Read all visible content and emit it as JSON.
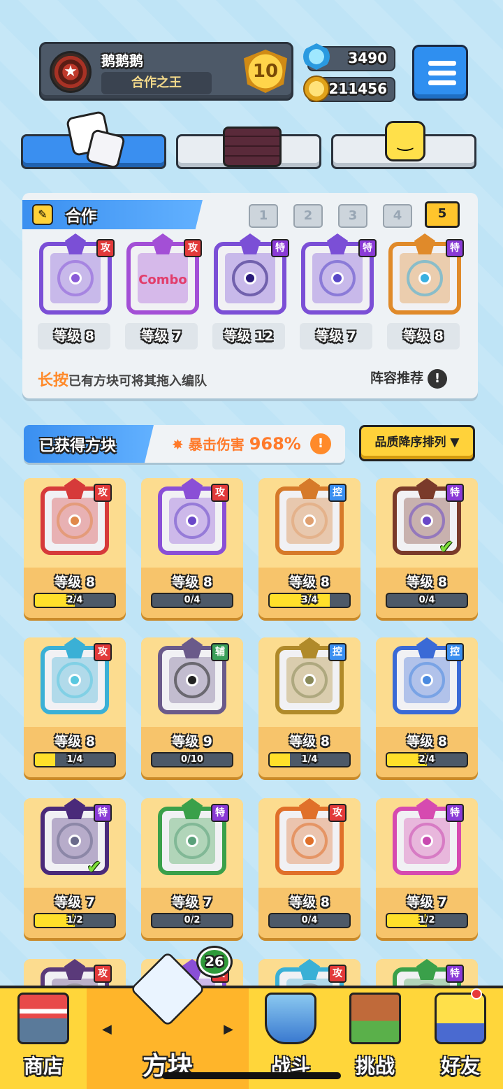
{
  "player": {
    "name": "鹅鹅鹅",
    "title": "合作之王",
    "rank": "10"
  },
  "currencies": {
    "gems": "3490",
    "coins": "211456"
  },
  "top_tabs": [
    "dice-tab",
    "board-tab",
    "emoji-tab"
  ],
  "team": {
    "label": "合作",
    "slots": [
      "1",
      "2",
      "3",
      "4",
      "5"
    ],
    "active_slot": "5",
    "members": [
      {
        "level": "等级 8",
        "tag": "攻",
        "color": "#7b4fd6",
        "accent": "#8a5bd8"
      },
      {
        "level": "等级 7",
        "tag": "攻",
        "color": "#a34fd6",
        "accent": "#e23d6b",
        "text": "Combo"
      },
      {
        "level": "等级 12",
        "tag": "特",
        "color": "#7b4fd6",
        "accent": "#2a1a7a"
      },
      {
        "level": "等级 7",
        "tag": "特",
        "color": "#7b4fd6",
        "accent": "#5a48c8"
      },
      {
        "level": "等级 8",
        "tag": "特",
        "color": "#e08a2a",
        "accent": "#3ab0e0"
      }
    ],
    "hint_highlight": "长按",
    "hint_rest": "已有方块可将其拖入编队",
    "recommend": "阵容推荐"
  },
  "owned": {
    "label": "已获得方块",
    "crit_label": "暴击伤害",
    "crit_value": "968%",
    "sort_label": "品质降序排列",
    "cards": [
      {
        "level": "等级 8",
        "progress": "2/4",
        "fill": 0.5,
        "tag": "攻",
        "color": "#d63a3a",
        "dot": "#e0884a"
      },
      {
        "level": "等级 8",
        "progress": "0/4",
        "fill": 0.0,
        "tag": "攻",
        "color": "#8a4fd6",
        "dot": "#6a48c8"
      },
      {
        "level": "等级 8",
        "progress": "3/4",
        "fill": 0.75,
        "tag": "控",
        "color": "#d67a2a",
        "dot": "#e0a070"
      },
      {
        "level": "等级 8",
        "progress": "0/4",
        "fill": 0.0,
        "tag": "特",
        "color": "#7a3a2a",
        "dot": "#6a48c8",
        "check": true
      },
      {
        "level": "等级 8",
        "progress": "1/4",
        "fill": 0.25,
        "tag": "攻",
        "color": "#3ab0d6",
        "dot": "#5ac8e0"
      },
      {
        "level": "等级 9",
        "progress": "0/10",
        "fill": 0.0,
        "tag": "辅",
        "color": "#6a5a8a",
        "dot": "#222222"
      },
      {
        "level": "等级 8",
        "progress": "1/4",
        "fill": 0.25,
        "tag": "控",
        "color": "#b08a2a",
        "dot": "#8a8a5a"
      },
      {
        "level": "等级 8",
        "progress": "2/4",
        "fill": 0.5,
        "tag": "控",
        "color": "#3a6ad6",
        "dot": "#4a8ae0"
      },
      {
        "level": "等级 7",
        "progress": "1/2",
        "fill": 0.5,
        "tag": "特",
        "color": "#4a2a7a",
        "dot": "#6a6a8a",
        "check": true
      },
      {
        "level": "等级 7",
        "progress": "0/2",
        "fill": 0.0,
        "tag": "特",
        "color": "#3aa04a",
        "dot": "#5aa07a"
      },
      {
        "level": "等级 8",
        "progress": "0/4",
        "fill": 0.0,
        "tag": "攻",
        "color": "#e0702a",
        "dot": "#e0702a"
      },
      {
        "level": "等级 7",
        "progress": "1/2",
        "fill": 0.5,
        "tag": "特",
        "color": "#d64ab0",
        "dot": "#c84ab0"
      }
    ],
    "partial_row_tags": [
      "攻",
      "攻",
      "攻",
      "特"
    ]
  },
  "tag_colors": {
    "攻": "#e23a3a",
    "控": "#3a8ff0",
    "特": "#8a3ad6",
    "辅": "#3aa05a"
  },
  "nav": {
    "items": [
      "商店",
      "方块",
      "战斗",
      "挑战",
      "好友"
    ],
    "active": "方块",
    "box_badge": "26"
  }
}
